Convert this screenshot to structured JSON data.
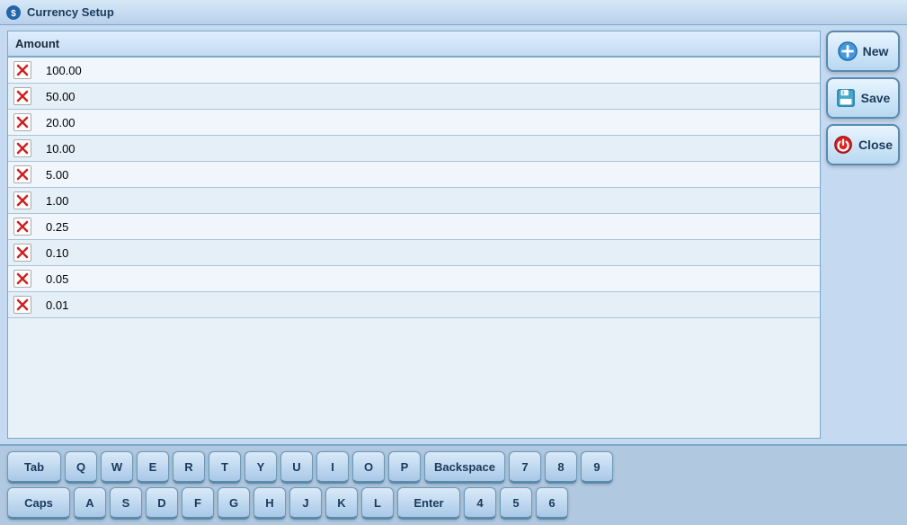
{
  "titleBar": {
    "title": "Currency Setup",
    "iconLabel": "app-icon"
  },
  "table": {
    "columnHeader": "Amount",
    "rows": [
      {
        "amount": "100.00"
      },
      {
        "amount": "50.00"
      },
      {
        "amount": "20.00"
      },
      {
        "amount": "10.00"
      },
      {
        "amount": "5.00"
      },
      {
        "amount": "1.00"
      },
      {
        "amount": "0.25"
      },
      {
        "amount": "0.10"
      },
      {
        "amount": "0.05"
      },
      {
        "amount": "0.01"
      }
    ]
  },
  "buttons": {
    "new": "New",
    "save": "Save",
    "close": "Close"
  },
  "keyboard": {
    "row1": [
      "Tab",
      "Q",
      "W",
      "E",
      "R",
      "T",
      "Y",
      "U",
      "I",
      "O",
      "P",
      "Backspace",
      "7",
      "8",
      "9"
    ],
    "row2": [
      "Caps",
      "A",
      "S",
      "D",
      "F",
      "G",
      "H",
      "J",
      "K",
      "L",
      "Enter",
      "4",
      "5",
      "6"
    ]
  }
}
